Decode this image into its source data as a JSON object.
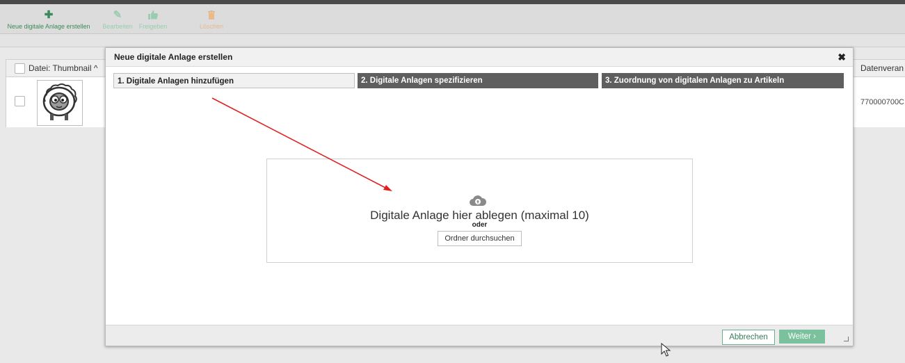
{
  "toolbar": {
    "items": [
      {
        "label": "Neue digitale Anlage erstellen",
        "icon": "plus-icon",
        "color": "#3c8a5a"
      },
      {
        "label": "Bearbeiten",
        "icon": "pencil-icon",
        "color": "#9acdb0"
      },
      {
        "label": "Freigeben",
        "icon": "thumbs-up-icon",
        "color": "#9acdb0"
      },
      {
        "label": "Löschen",
        "icon": "trash-icon",
        "color": "#e9b98c"
      }
    ]
  },
  "grid": {
    "columns": [
      {
        "label": "Datei: Thumbnail ^"
      },
      {
        "label": "Datenveran"
      }
    ],
    "rows": [
      {
        "value": "770000700C"
      }
    ]
  },
  "modal": {
    "title": "Neue digitale Anlage erstellen",
    "close_icon": "close-icon",
    "steps": [
      {
        "label": "1. Digitale Anlagen hinzufügen",
        "state": "active"
      },
      {
        "label": "2. Digitale Anlagen spezifizieren",
        "state": "inactive"
      },
      {
        "label": "3. Zuordnung von digitalen Anlagen zu Artikeln",
        "state": "inactive"
      }
    ],
    "dropzone": {
      "icon": "cloud-upload-icon",
      "text": "Digitale Anlage hier ablegen (maximal 10)",
      "or": "oder",
      "browse_label": "Ordner durchsuchen"
    },
    "footer": {
      "cancel_label": "Abbrechen",
      "next_label": "Weiter ›"
    }
  },
  "colors": {
    "accent_green": "#7cc19d",
    "step_inactive": "#5f5f5f",
    "annotation_arrow": "#e02020"
  }
}
